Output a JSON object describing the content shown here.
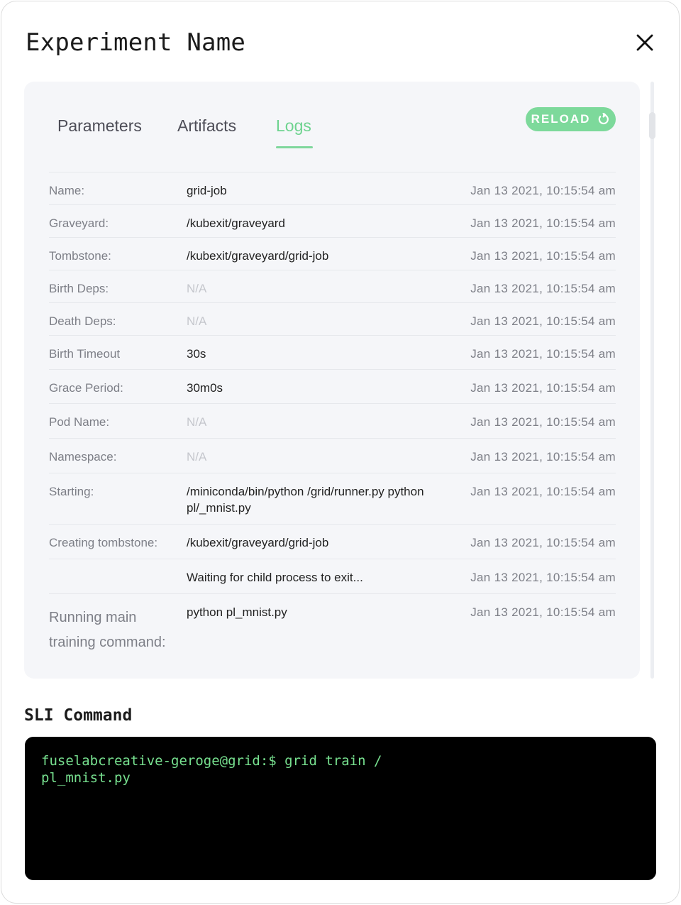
{
  "modal": {
    "title": "Experiment Name"
  },
  "tabs": [
    {
      "label": "Parameters"
    },
    {
      "label": "Artifacts"
    },
    {
      "label": "Logs"
    }
  ],
  "reload_label": "RELOAD",
  "logs": [
    {
      "label": "Name:",
      "value": "grid-job",
      "time": "Jan 13 2021, 10:15:54 am"
    },
    {
      "label": "Graveyard:",
      "value": "/kubexit/graveyard",
      "time": "Jan 13 2021, 10:15:54 am"
    },
    {
      "label": "Tombstone:",
      "value": "/kubexit/graveyard/grid-job",
      "time": "Jan 13 2021, 10:15:54 am"
    },
    {
      "label": "Birth Deps:",
      "value": "N/A",
      "time": "Jan 13 2021, 10:15:54 am"
    },
    {
      "label": "Death Deps:",
      "value": "N/A",
      "time": "Jan 13 2021, 10:15:54 am"
    },
    {
      "label": "Birth Timeout",
      "value": "30s",
      "time": "Jan 13 2021, 10:15:54 am"
    },
    {
      "label": "Grace Period:",
      "value": "30m0s",
      "time": "Jan 13 2021, 10:15:54 am"
    },
    {
      "label": "Pod Name:",
      "value": "N/A",
      "time": "Jan 13 2021, 10:15:54 am"
    },
    {
      "label": "Namespace:",
      "value": "N/A",
      "time": "Jan 13 2021, 10:15:54 am"
    },
    {
      "label": "Starting:",
      "value": "/miniconda/bin/python /grid/runner.py python pl/_mnist.py",
      "time": "Jan 13 2021, 10:15:54 am"
    },
    {
      "label": "Creating tombstone:",
      "value": "/kubexit/graveyard/grid-job",
      "time": "Jan 13 2021, 10:15:54 am"
    },
    {
      "label": "",
      "value": "Waiting for child process to exit...",
      "time": "Jan 13 2021, 10:15:54 am"
    },
    {
      "label": "Running main training command:",
      "value": "python pl_mnist.py",
      "time": "Jan 13 2021, 10:15:54 am"
    }
  ],
  "sli": {
    "title": "SLI Command",
    "command": "fuselabcreative-geroge@grid:$ grid train /\npl_mnist.py"
  },
  "colors": {
    "accent": "#6ed38f",
    "terminal_text": "#77e08f"
  }
}
